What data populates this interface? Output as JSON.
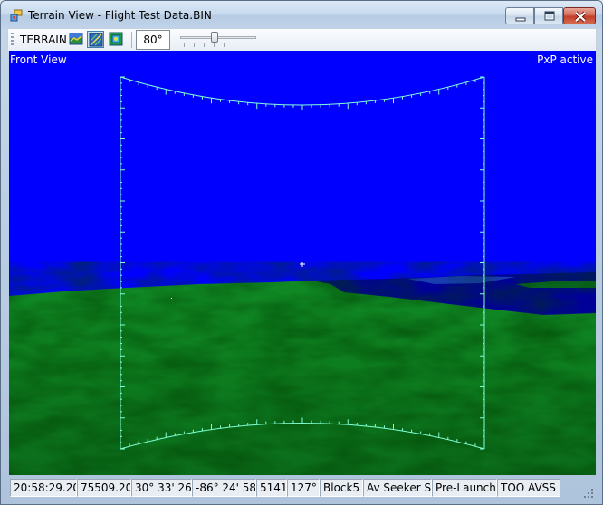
{
  "window": {
    "title": "Terrain View - Flight Test Data.BIN",
    "controls": [
      "minimize",
      "maximize",
      "close"
    ]
  },
  "toolbar": {
    "terrain_label": "TERRAIN",
    "buttons": [
      {
        "icon": "terrain-map-icon",
        "active": false
      },
      {
        "icon": "wireframe-terrain-icon",
        "active": true
      },
      {
        "icon": "texture-terrain-icon",
        "active": false
      }
    ],
    "fov_value": "80°",
    "fov_slider": {
      "fraction": 0.45
    }
  },
  "viewport": {
    "view_label": "Front View",
    "status_label": "PxP active",
    "colors": {
      "sky": "#0000ff",
      "terrain": "#0e7a1e",
      "water": "#000099",
      "reticle": "#7fffd4"
    }
  },
  "status_bar": {
    "time": "20:58:29.200",
    "counter": "75509.200",
    "latitude": "30° 33' 26\"",
    "longitude": "-86° 24' 58\"",
    "altitude": "5141",
    "heading": "127°",
    "block": "Block5",
    "seeker": "Av Seeker St",
    "phase": "Pre-Launch",
    "mode": "TOO AVSS"
  }
}
